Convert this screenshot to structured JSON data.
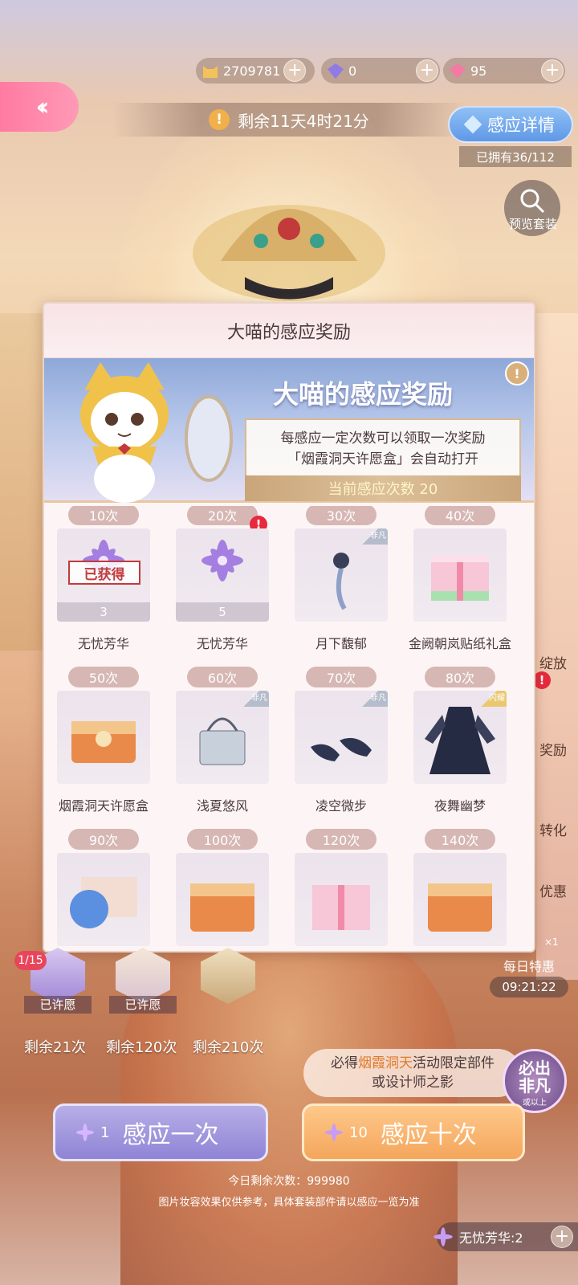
{
  "currency": {
    "coins": "2709781",
    "diamonds_blue": "0",
    "diamonds_pink": "95"
  },
  "timer": "剩余11天4时21分",
  "detail_button": "感应详情",
  "owned": "已拥有36/112",
  "preview_label": "预览套装",
  "side": {
    "t1": "绽放",
    "t2": "奖励",
    "t3": "转化",
    "t4": "优惠"
  },
  "daily": {
    "label": "每日特惠",
    "time": "09:21:22",
    "mult": "×1"
  },
  "modal": {
    "title": "大喵的感应奖励",
    "banner_title": "大喵的感应奖励",
    "info_line1": "每感应一定次数可以领取一次奖励",
    "info_line2": "「烟霞洞天许愿盒」会自动打开",
    "current_count": "当前感应次数 20",
    "rewards": [
      {
        "count": "10次",
        "name": "无忧芳华",
        "qty": "3",
        "obtained": "已获得"
      },
      {
        "count": "20次",
        "name": "无忧芳华",
        "qty": "5"
      },
      {
        "count": "30次",
        "name": "月下馥郁",
        "tag": "非凡"
      },
      {
        "count": "40次",
        "name": "金阙朝岚贴纸礼盒"
      },
      {
        "count": "50次",
        "name": "烟霞洞天许愿盒"
      },
      {
        "count": "60次",
        "name": "浅夏悠风",
        "tag": "非凡"
      },
      {
        "count": "70次",
        "name": "凌空微步",
        "tag": "非凡"
      },
      {
        "count": "80次",
        "name": "夜舞幽梦",
        "tag": "闪耀"
      },
      {
        "count": "90次"
      },
      {
        "count": "100次"
      },
      {
        "count": "120次"
      },
      {
        "count": "140次"
      }
    ]
  },
  "wishes": {
    "progress": "1/15",
    "items": [
      {
        "status": "已许愿",
        "remain": "剩余21次"
      },
      {
        "status": "已许愿",
        "remain": "剩余120次"
      },
      {
        "status": "",
        "remain": "剩余210次"
      }
    ]
  },
  "guarantee": {
    "pre": "必得",
    "highlight": "烟霞洞天",
    "post": "活动限定部件",
    "line2": "或设计师之影"
  },
  "must_badge": {
    "line1": "必出",
    "line2": "非凡",
    "small": "或以上"
  },
  "buttons": {
    "one": {
      "num": "1",
      "label": "感应一次"
    },
    "ten": {
      "num": "10",
      "label": "感应十次"
    }
  },
  "footer": {
    "today": "今日剩余次数：999980",
    "note": "图片妆容效果仅供参考，具体套装部件请以感应一览为准"
  },
  "bottom_resource": "无忧芳华:2",
  "colors": {
    "accent_pink": "#ff8aab",
    "accent_blue": "#6fa4ea",
    "gold": "#e8c6a0"
  }
}
